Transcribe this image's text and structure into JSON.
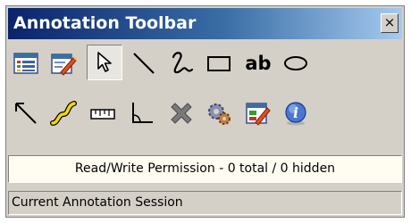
{
  "window": {
    "title": "Annotation Toolbar",
    "close_glyph": "×"
  },
  "toolbar": {
    "text_tool_label": "ab",
    "selected_tool": "pointer-icon",
    "rows": [
      [
        "annotation-list-icon",
        "edit-properties-icon",
        "pointer-icon",
        "line-icon",
        "freehand-icon",
        "rectangle-icon",
        "text-tool",
        "ellipse-icon"
      ],
      [
        "arrow-icon",
        "highlight-curve-icon",
        "measure-ruler-icon",
        "angle-icon",
        "delete-icon",
        "settings-icon",
        "edit-annotation-icon",
        "info-icon"
      ]
    ]
  },
  "status": {
    "text": "Read/Write Permission - 0 total / 0 hidden"
  },
  "session": {
    "text": "Current Annotation Session"
  },
  "colors": {
    "title_gradient_start": "#0a246a",
    "title_gradient_end": "#a6caf0",
    "window_face": "#d4d0c8",
    "status_background": "#fffdf2",
    "highlight_yellow": "#f5d800"
  }
}
